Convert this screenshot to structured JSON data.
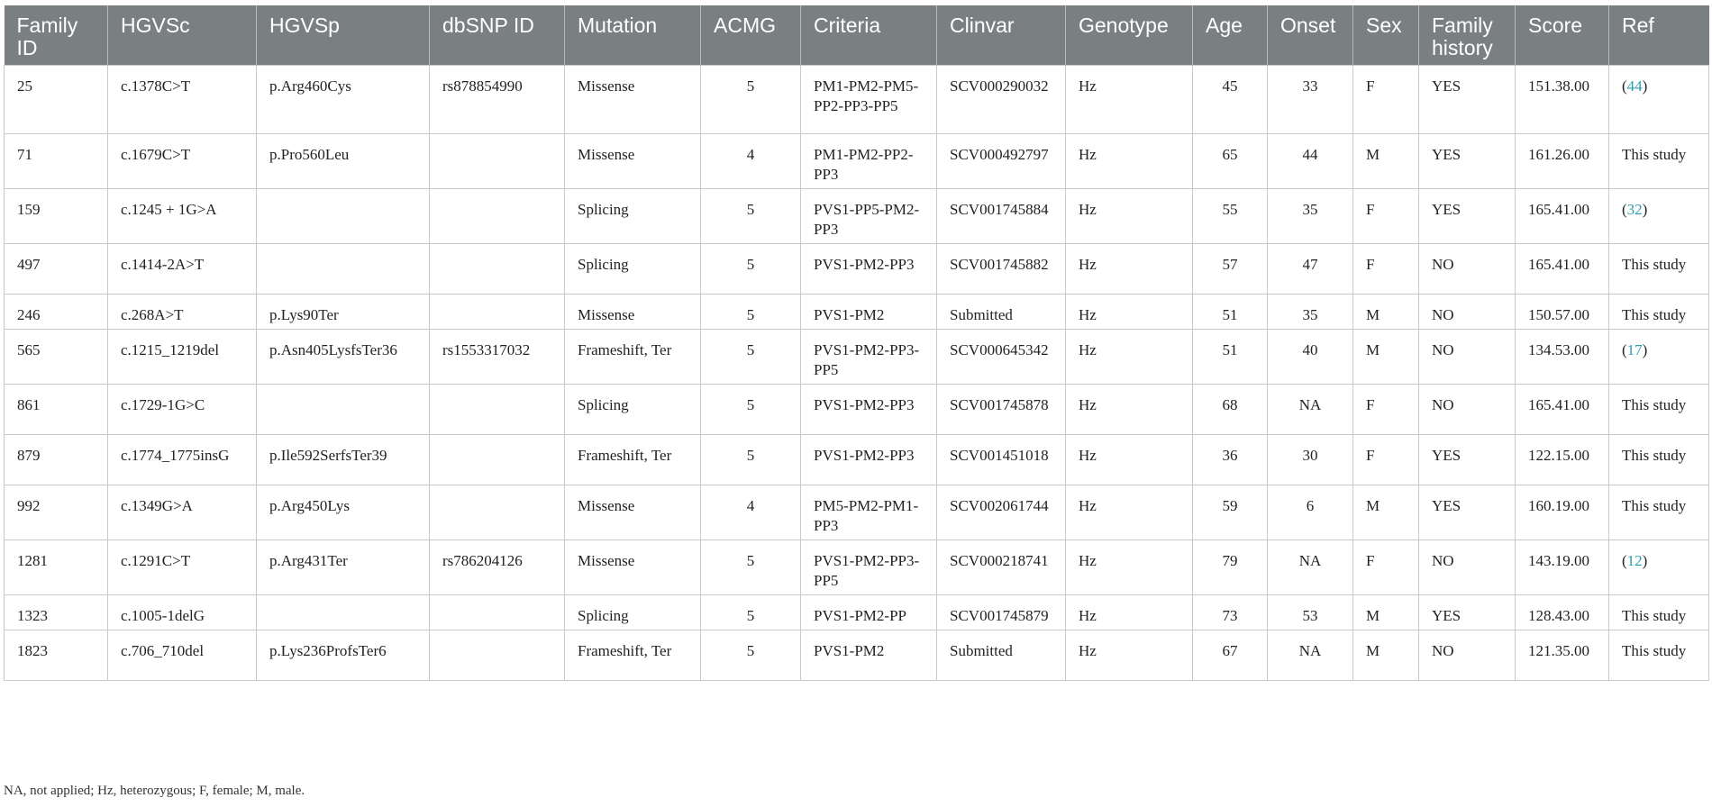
{
  "columns": [
    "Family ID",
    "HGVSc",
    "HGVSp",
    "dbSNP ID",
    "Mutation",
    "ACMG",
    "Criteria",
    "Clinvar",
    "Genotype",
    "Age",
    "Onset",
    "Sex",
    "Family history",
    "Score",
    "Ref"
  ],
  "rows": [
    {
      "family_id": "25",
      "hgvsc": "c.1378C>T",
      "hgvsp": "p.Arg460Cys",
      "dbsnp": "rs878854990",
      "mutation": "Missense",
      "acmg": "5",
      "criteria": "PM1-PM2-PM5-PP2-PP3-PP5",
      "clinvar": "SCV000290032",
      "genotype": "Hz",
      "age": "45",
      "onset": "33",
      "sex": "F",
      "family_history": "YES",
      "score": "151.38.00",
      "ref": "(44)",
      "ref_num": "44"
    },
    {
      "family_id": "71",
      "hgvsc": "c.1679C>T",
      "hgvsp": "p.Pro560Leu",
      "dbsnp": "",
      "mutation": "Missense",
      "acmg": "4",
      "criteria": "PM1-PM2-PP2-PP3",
      "clinvar": "SCV000492797",
      "genotype": "Hz",
      "age": "65",
      "onset": "44",
      "sex": "M",
      "family_history": "YES",
      "score": "161.26.00",
      "ref": "This study",
      "ref_num": ""
    },
    {
      "family_id": "159",
      "hgvsc": "c.1245 + 1G>A",
      "hgvsp": "",
      "dbsnp": "",
      "mutation": "Splicing",
      "acmg": "5",
      "criteria": "PVS1-PP5-PM2-PP3",
      "clinvar": "SCV001745884",
      "genotype": "Hz",
      "age": "55",
      "onset": "35",
      "sex": "F",
      "family_history": "YES",
      "score": "165.41.00",
      "ref": "(32)",
      "ref_num": "32"
    },
    {
      "family_id": "497",
      "hgvsc": "c.1414-2A>T",
      "hgvsp": "",
      "dbsnp": "",
      "mutation": "Splicing",
      "acmg": "5",
      "criteria": "PVS1-PM2-PP3",
      "clinvar": "SCV001745882",
      "genotype": "Hz",
      "age": "57",
      "onset": "47",
      "sex": "F",
      "family_history": "NO",
      "score": "165.41.00",
      "ref": "This study",
      "ref_num": ""
    },
    {
      "family_id": "246",
      "hgvsc": "c.268A>T",
      "hgvsp": "p.Lys90Ter",
      "dbsnp": "",
      "mutation": "Missense",
      "acmg": "5",
      "criteria": "PVS1-PM2",
      "clinvar": "Submitted",
      "genotype": "Hz",
      "age": "51",
      "onset": "35",
      "sex": "M",
      "family_history": "NO",
      "score": "150.57.00",
      "ref": "This study",
      "ref_num": ""
    },
    {
      "family_id": "565",
      "hgvsc": "c.1215_1219del",
      "hgvsp": "p.Asn405LysfsTer36",
      "dbsnp": "rs1553317032",
      "mutation": "Frameshift, Ter",
      "acmg": "5",
      "criteria": "PVS1-PM2-PP3-PP5",
      "clinvar": "SCV000645342",
      "genotype": "Hz",
      "age": "51",
      "onset": "40",
      "sex": "M",
      "family_history": "NO",
      "score": "134.53.00",
      "ref": "(17)",
      "ref_num": "17"
    },
    {
      "family_id": "861",
      "hgvsc": "c.1729-1G>C",
      "hgvsp": "",
      "dbsnp": "",
      "mutation": "Splicing",
      "acmg": "5",
      "criteria": "PVS1-PM2-PP3",
      "clinvar": "SCV001745878",
      "genotype": "Hz",
      "age": "68",
      "onset": "NA",
      "sex": "F",
      "family_history": "NO",
      "score": "165.41.00",
      "ref": "This study",
      "ref_num": ""
    },
    {
      "family_id": "879",
      "hgvsc": "c.1774_1775insG",
      "hgvsp": "p.Ile592SerfsTer39",
      "dbsnp": "",
      "mutation": "Frameshift, Ter",
      "acmg": "5",
      "criteria": "PVS1-PM2-PP3",
      "clinvar": "SCV001451018",
      "genotype": "Hz",
      "age": "36",
      "onset": "30",
      "sex": "F",
      "family_history": "YES",
      "score": "122.15.00",
      "ref": "This study",
      "ref_num": ""
    },
    {
      "family_id": "992",
      "hgvsc": "c.1349G>A",
      "hgvsp": "p.Arg450Lys",
      "dbsnp": "",
      "mutation": "Missense",
      "acmg": "4",
      "criteria": "PM5-PM2-PM1-PP3",
      "clinvar": "SCV002061744",
      "genotype": "Hz",
      "age": "59",
      "onset": "6",
      "sex": "M",
      "family_history": "YES",
      "score": "160.19.00",
      "ref": "This study",
      "ref_num": ""
    },
    {
      "family_id": "1281",
      "hgvsc": "c.1291C>T",
      "hgvsp": "p.Arg431Ter",
      "dbsnp": "rs786204126",
      "mutation": "Missense",
      "acmg": "5",
      "criteria": "PVS1-PM2-PP3-PP5",
      "clinvar": "SCV000218741",
      "genotype": "Hz",
      "age": "79",
      "onset": "NA",
      "sex": "F",
      "family_history": "NO",
      "score": "143.19.00",
      "ref": "(12)",
      "ref_num": "12"
    },
    {
      "family_id": "1323",
      "hgvsc": "c.1005-1delG",
      "hgvsp": "",
      "dbsnp": "",
      "mutation": "Splicing",
      "acmg": "5",
      "criteria": "PVS1-PM2-PP",
      "clinvar": "SCV001745879",
      "genotype": "Hz",
      "age": "73",
      "onset": "53",
      "sex": "M",
      "family_history": "YES",
      "score": "128.43.00",
      "ref": "This study",
      "ref_num": ""
    },
    {
      "family_id": "1823",
      "hgvsc": "c.706_710del",
      "hgvsp": "p.Lys236ProfsTer6",
      "dbsnp": "",
      "mutation": "Frameshift, Ter",
      "acmg": "5",
      "criteria": "PVS1-PM2",
      "clinvar": "Submitted",
      "genotype": "Hz",
      "age": "67",
      "onset": "NA",
      "sex": "M",
      "family_history": "NO",
      "score": "121.35.00",
      "ref": "This study",
      "ref_num": ""
    }
  ],
  "footnote": "NA, not applied; Hz, heterozygous; F, female; M, male.",
  "colors": {
    "header_bg": "#7a7f82",
    "header_text": "#ffffff",
    "border": "#c9c9c9",
    "ref_link": "#2a9db0"
  }
}
